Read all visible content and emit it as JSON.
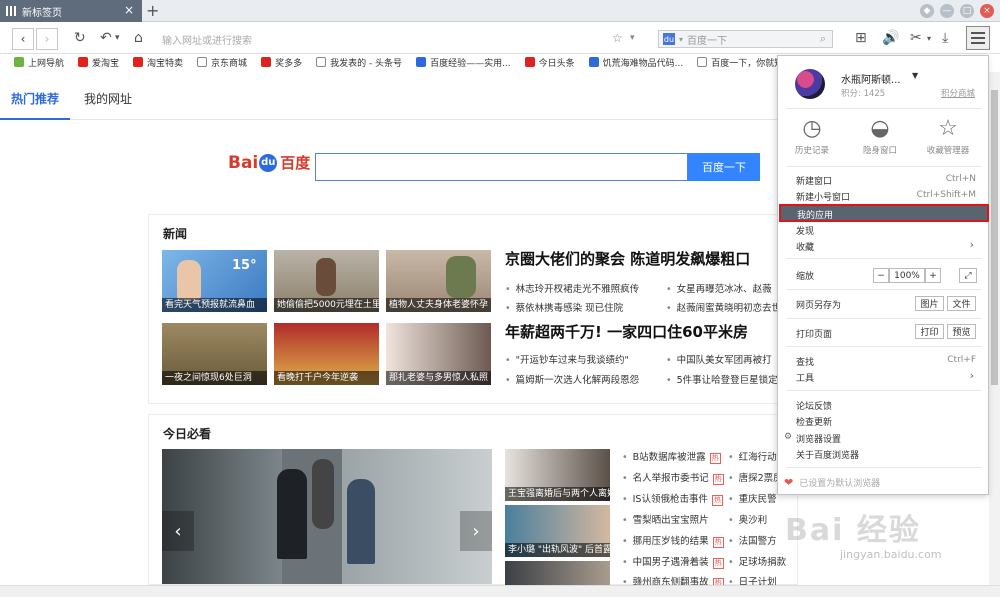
{
  "tab": {
    "title": "新标签页",
    "close": "×",
    "new": "+"
  },
  "window": {
    "btn1": "◆",
    "btn2": "—",
    "btn3": "□",
    "close": "×"
  },
  "toolbar": {
    "back": "‹",
    "forward": "›",
    "reload": "↻",
    "undo": "↶",
    "undo_caret": "▾",
    "home": "⌂",
    "address_placeholder": "输入网址或进行搜索",
    "star": "☆",
    "star_caret": "▾",
    "search_placeholder": "百度一下",
    "search_caret": "▾",
    "search_mag": "⌕",
    "icons": [
      "⊞",
      "🔊",
      "✂",
      "⤓"
    ],
    "cut_caret": "▾"
  },
  "bookmarks": [
    {
      "label": "上网导航",
      "color": "#6cb33f"
    },
    {
      "label": "爱淘宝",
      "color": "#e2231a"
    },
    {
      "label": "淘宝特卖",
      "color": "#e2231a"
    },
    {
      "label": "京东商城",
      "color": "#ffffff"
    },
    {
      "label": "奖多多",
      "color": "#d22"
    },
    {
      "label": "我发表的 - 头条号",
      "color": "#ffffff"
    },
    {
      "label": "百度经验——实用...",
      "color": "#2d6ae0"
    },
    {
      "label": "今日头条",
      "color": "#d22"
    },
    {
      "label": "饥荒海难物品代码...",
      "color": "#2d6ae0"
    },
    {
      "label": "百度一下，你就知道",
      "color": "#ffffff"
    }
  ],
  "nav": {
    "tab1": "热门推荐",
    "tab2": "我的网址"
  },
  "baidu": {
    "logo_a": "Bai",
    "logo_du": "du",
    "logo_cn": "百度",
    "button": "百度一下"
  },
  "news": {
    "title": "新闻",
    "thumbs": [
      "看完天气预报就流鼻血",
      "她偷偷把5000元埋在土里",
      "植物人丈夫身体老婆怀孕",
      "一夜之间惊现6处巨洞",
      "看晚打千户今年逆袭",
      "那扎老婆与多男惊人私照"
    ],
    "thumb_temp": "15°",
    "headline1": "京圈大佬们的聚会 陈道明发飙爆粗口",
    "headline2": "年薪超两千万! 一家四口住60平米房",
    "items": [
      "林志玲开杈裙走光不雅照疯传",
      "女星再曝范冰冰、赵薇",
      "蔡依林携毒感染 现已住院",
      "赵薇闹蜜黄晓明初恋去世",
      "\"开运钞车过来与我谈绩约\"",
      "中国队美女军团再被打",
      "篇姆斯一次选人化解两段恩怨",
      "5件事让哈登登巨星锁定"
    ]
  },
  "today": {
    "title": "今日必看",
    "side_caps": [
      "王宝强离婚后与两个人离婚",
      "李小璐 \"出轨风波\" 后首露",
      ""
    ],
    "left_items": [
      "B站数据库被泄露",
      "名人举报市委书记",
      "IS认领俄枪击事件",
      "雪梨晒出宝宝照片",
      "挪用压岁钱的结果",
      "中国男子遇滑着装",
      "赣州商东侧翻事故"
    ],
    "right_items": [
      "红海行动",
      "唐探2票房",
      "重庆民警",
      "奥沙利",
      "法国警方",
      "足球场捐款",
      "日子计划"
    ],
    "hot": "热",
    "arrow_left": "‹",
    "arrow_right": "›"
  },
  "menu": {
    "user": "水瓶阿斯顿...",
    "caret": "▼",
    "points": "积分: 1425",
    "mall": "积分商城",
    "quick": [
      {
        "icon": "◷",
        "label": "历史记录"
      },
      {
        "icon": "◒",
        "label": "隐身窗口"
      },
      {
        "icon": "☆",
        "label": "收藏管理器"
      }
    ],
    "new_window": "新建窗口",
    "new_window_sc": "Ctrl+N",
    "new_small": "新建小号窗口",
    "new_small_sc": "Ctrl+Shift+M",
    "my_apps": "我的应用",
    "discover": "发现",
    "favorites": "收藏",
    "zoom_label": "缩放",
    "zoom_minus": "−",
    "zoom_value": "100%",
    "zoom_plus": "+",
    "fullscreen": "⤢",
    "save_as": "网页另存为",
    "save_img": "图片",
    "save_file": "文件",
    "print": "打印页面",
    "print_btn": "打印",
    "preview_btn": "预览",
    "find": "查找",
    "find_sc": "Ctrl+F",
    "tools": "工具",
    "forum": "论坛反馈",
    "update": "检查更新",
    "settings": "浏览器设置",
    "about": "关于百度浏览器",
    "default": "已设置为默认浏览器",
    "chev": "›",
    "heart": "❤",
    "gear": "⚙"
  },
  "watermark": {
    "text": "Bai 经验",
    "url": "jingyan.baidu.com"
  }
}
